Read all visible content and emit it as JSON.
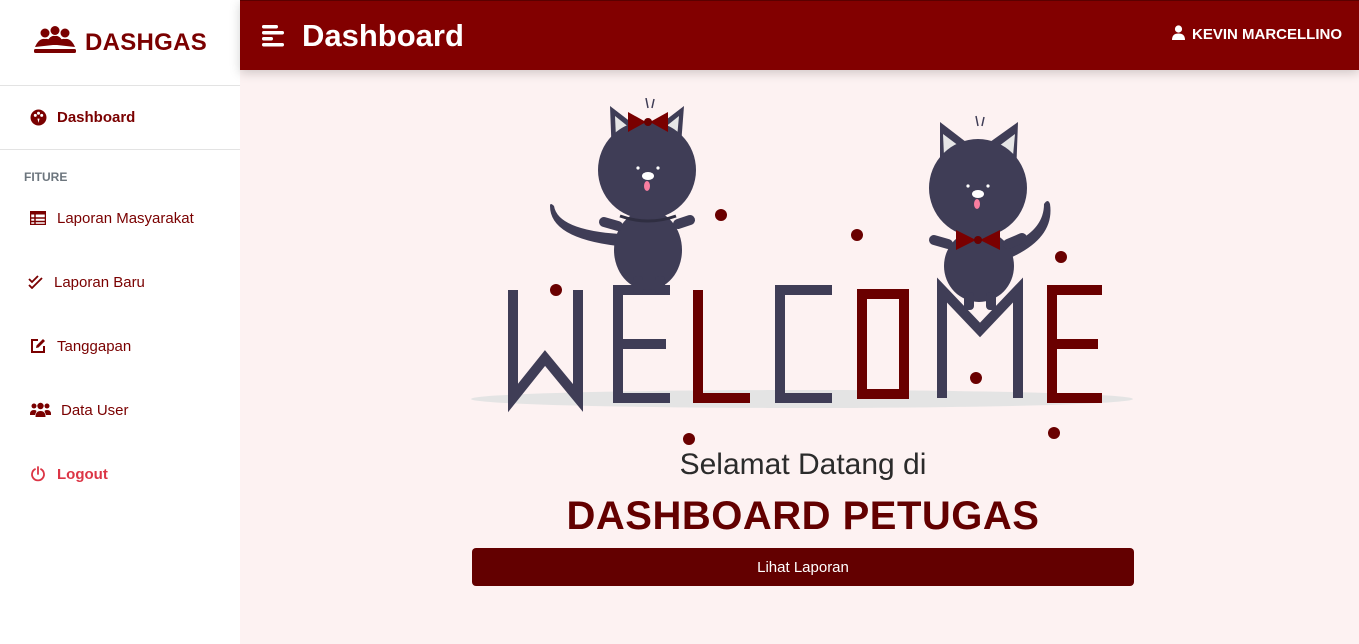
{
  "brand": {
    "name": "DASHGAS",
    "icon": "users-group-icon"
  },
  "sidebar": {
    "active_item": {
      "label": "Dashboard",
      "icon": "palette-icon"
    },
    "section_title": "FITURE",
    "items": [
      {
        "label": "Laporan Masyarakat",
        "icon": "table-icon"
      },
      {
        "label": "Laporan Baru",
        "icon": "double-check-icon"
      },
      {
        "label": "Tanggapan",
        "icon": "edit-icon"
      },
      {
        "label": "Data User",
        "icon": "users-icon"
      }
    ],
    "logout": {
      "label": "Logout",
      "icon": "power-icon"
    }
  },
  "topbar": {
    "title": "Dashboard",
    "user": "KEVIN MARCELLINO"
  },
  "main": {
    "greeting": "Selamat Datang di",
    "headline": "DASHBOARD PETUGAS",
    "button_label": "Lihat Laporan",
    "illustration_text": "WELCOME"
  },
  "colors": {
    "primary": "#820000",
    "dark_primary": "#630000",
    "danger": "#dc3545",
    "background": "#fdf2f2",
    "ink": "#3f3d56"
  }
}
